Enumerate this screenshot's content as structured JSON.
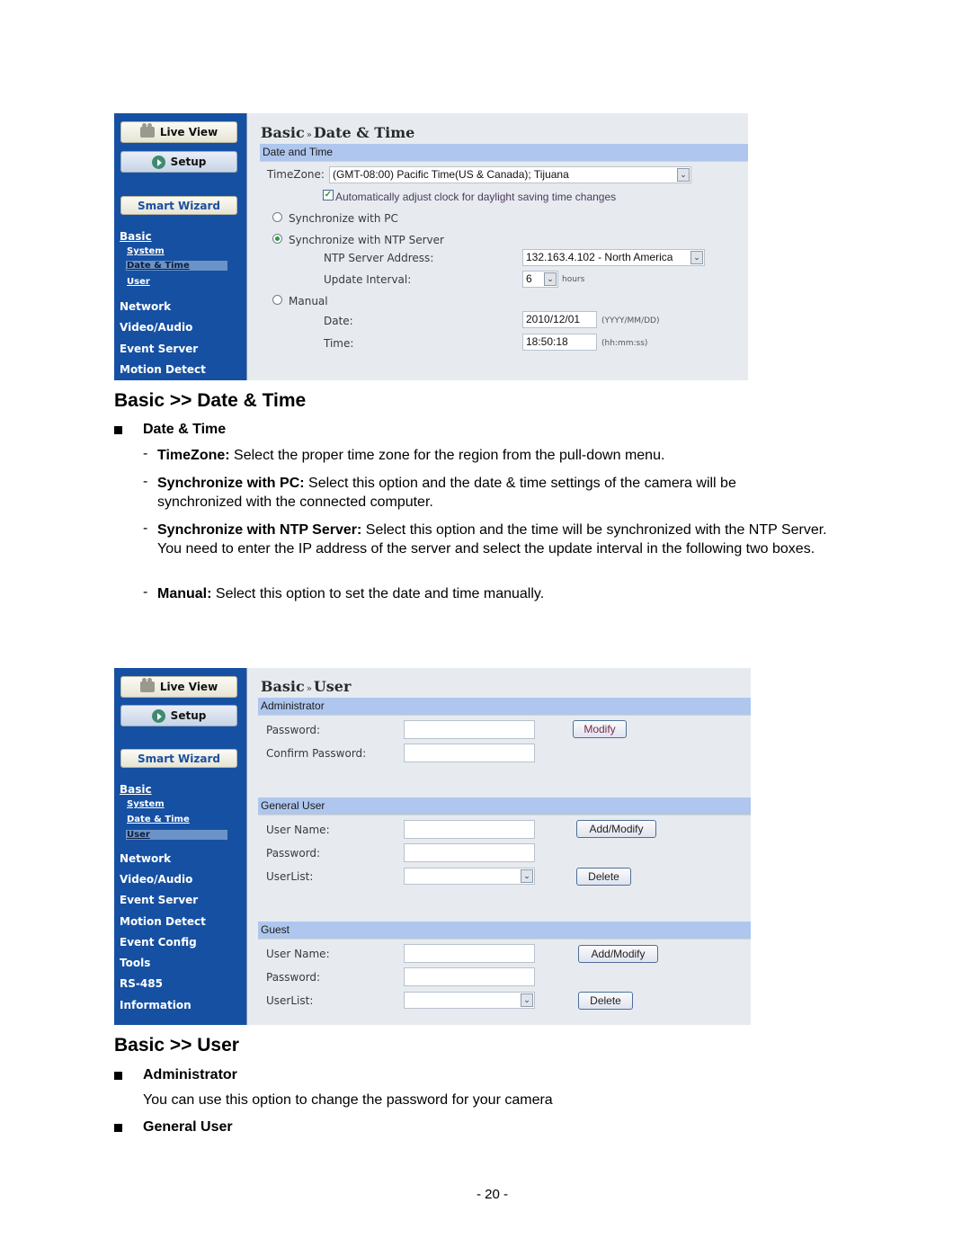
{
  "screenshot1": {
    "sidebar": {
      "live_view": "Live View",
      "setup": "Setup",
      "smart_wizard": "Smart Wizard",
      "basic": "Basic",
      "system": "System",
      "date_time": "Date & Time",
      "user": "User",
      "items": [
        "Network",
        "Video/Audio",
        "Event Server",
        "Motion Detect"
      ]
    },
    "title_part1": "Basic",
    "title_sep": "»",
    "title_part2": "Date & Time",
    "section": "Date and Time",
    "timezone_label": "TimeZone:",
    "timezone_value": "(GMT-08:00) Pacific Time(US & Canada); Tijuana",
    "dst_label": "Automatically adjust clock for daylight saving time changes",
    "dst_checked": true,
    "sync_pc_label": "Synchronize with PC",
    "sync_ntp_label": "Synchronize with NTP Server",
    "selected_mode": "ntp",
    "ntp_address_label": "NTP Server Address:",
    "ntp_address_value": "132.163.4.102 - North America",
    "update_interval_label": "Update Interval:",
    "update_interval_value": "6",
    "update_interval_unit": "hours",
    "manual_label": "Manual",
    "date_label": "Date:",
    "date_value": "2010/12/01",
    "date_hint": "(YYYY/MM/DD)",
    "time_label": "Time:",
    "time_value": "18:50:18",
    "time_hint": "(hh:mm:ss)"
  },
  "doc1": {
    "heading": "Basic >> Date & Time",
    "subheading": "Date & Time",
    "items": [
      {
        "term": "TimeZone:",
        "text": " Select the proper time zone for the region from the pull-down menu."
      },
      {
        "term": "Synchronize with PC:",
        "text": " Select this option and the date & time settings of the camera will be synchronized with the connected computer."
      },
      {
        "term": "Synchronize with NTP Server:",
        "text": " Select this option and the time will be synchronized with the NTP Server. You need to enter the IP address of the server and select the update interval in the following two boxes."
      },
      {
        "term": "Manual:",
        "text": " Select this option to set the date and time manually."
      }
    ]
  },
  "screenshot2": {
    "sidebar": {
      "live_view": "Live View",
      "setup": "Setup",
      "smart_wizard": "Smart Wizard",
      "basic": "Basic",
      "system": "System",
      "date_time": "Date & Time",
      "user": "User",
      "items": [
        "Network",
        "Video/Audio",
        "Event Server",
        "Motion Detect",
        "Event Config",
        "Tools",
        "RS-485",
        "Information"
      ]
    },
    "title_part1": "Basic",
    "title_sep": "»",
    "title_part2": "User",
    "admin": {
      "section": "Administrator",
      "password_label": "Password:",
      "password_value": "",
      "confirm_label": "Confirm Password:",
      "confirm_value": "",
      "modify_button": "Modify"
    },
    "general": {
      "section": "General User",
      "username_label": "User Name:",
      "username_value": "",
      "password_label": "Password:",
      "password_value": "",
      "userlist_label": "UserList:",
      "userlist_value": "",
      "add_button": "Add/Modify",
      "delete_button": "Delete"
    },
    "guest": {
      "section": "Guest",
      "username_label": "User Name:",
      "username_value": "",
      "password_label": "Password:",
      "password_value": "",
      "userlist_label": "UserList:",
      "userlist_value": "",
      "add_button": "Add/Modify",
      "delete_button": "Delete"
    }
  },
  "doc2": {
    "heading": "Basic >> User",
    "admin_heading": "Administrator",
    "admin_text": "You can use this option to change the password for your camera",
    "general_heading": "General User"
  },
  "page_number": "- 20 -"
}
